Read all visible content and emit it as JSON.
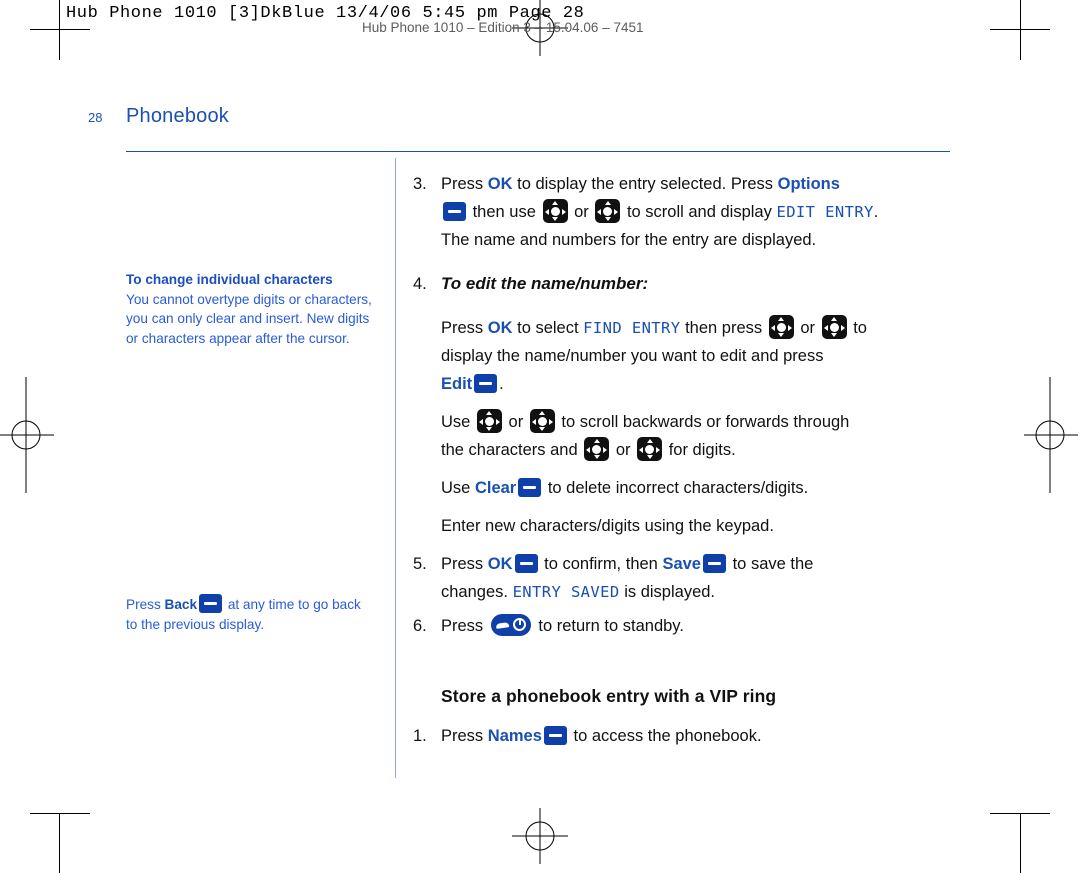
{
  "slug": {
    "imposition": "Hub Phone 1010 [3]DkBlue  13/4/06  5:45 pm  Page 28",
    "running_head": "Hub Phone 1010 – Edition 3 – 15.04.06 – 7451"
  },
  "page": {
    "number": "28",
    "chapter": "Phonebook",
    "accent_color": "#1a4fb4"
  },
  "notes": [
    {
      "title": "To change individual characters",
      "text": "You cannot overtype digits or characters, you can only clear and insert. New digits or characters appear after the cursor."
    },
    {
      "lead": "Press",
      "key": "Back",
      "text": "at any time to go back to the previous display."
    }
  ],
  "steps": {
    "s3": {
      "num": "3.",
      "t1": "Press",
      "b1": "OK",
      "t2": "to display the entry selected. Press",
      "b2": "Options",
      "t3": "then use",
      "t4": "or",
      "t5": "to scroll and display",
      "lcd1": "EDIT ENTRY",
      "t6": ".",
      "t7": "The name and numbers for the entry are displayed."
    },
    "s4": {
      "num": "4.",
      "title": "To edit the name/number:",
      "p1_t1": "Press",
      "p1_b1": "OK",
      "p1_t2": "to select",
      "p1_lcd": "FIND ENTRY",
      "p1_t3": "then press",
      "p1_t4": "or",
      "p1_t5": "to",
      "p1_t6": "display the name/number you want to edit and press",
      "p1_b2": "Edit",
      "p1_t7": ".",
      "p2_t1": "Use",
      "p2_t2": "or",
      "p2_t3": "to scroll backwards or forwards through",
      "p2_t4": "the characters and",
      "p2_t5": "or",
      "p2_t6": "for digits.",
      "p3_t1": "Use",
      "p3_b1": "Clear",
      "p3_t2": "to delete incorrect characters/digits.",
      "p4": "Enter new characters/digits using the keypad."
    },
    "s5": {
      "num": "5.",
      "t1": "Press",
      "b1": "OK",
      "t2": "to confirm, then",
      "b2": "Save",
      "t3": "to save the",
      "t4": "changes.",
      "lcd": "ENTRY SAVED",
      "t5": "is displayed."
    },
    "s6": {
      "num": "6.",
      "t1": "Press",
      "t2": "to return to standby."
    }
  },
  "section": {
    "heading": "Store a phonebook entry with a VIP ring",
    "s1": {
      "num": "1.",
      "t1": "Press",
      "b1": "Names",
      "t2": "to access the phonebook."
    }
  }
}
